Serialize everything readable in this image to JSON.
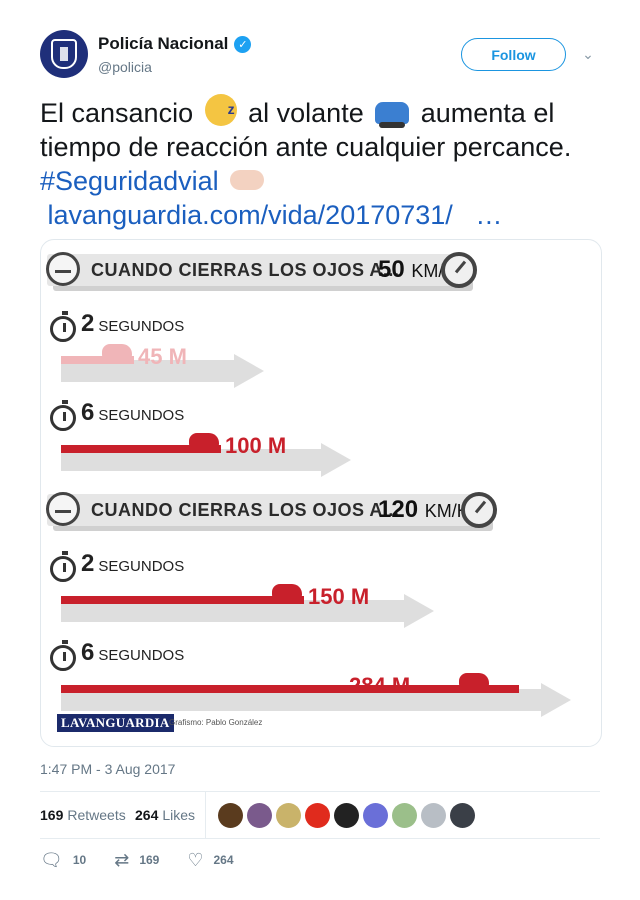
{
  "author": {
    "display_name": "Policía Nacional",
    "handle": "@policia",
    "avatar_icon": "police-badge-icon",
    "verified_icon": "verified-badge-icon"
  },
  "follow_button": {
    "label": "Follow"
  },
  "menu_icon": "chevron-down-icon",
  "tweet": {
    "line1_part1": "El cansancio",
    "line1_part2": "al volante",
    "line1_part3": "aumenta el",
    "line2": "tiempo de reacción ante cualquier percance.",
    "hashtag": "#Seguridadvial",
    "link": "lavanguardia.com/vida/20170731/",
    "ellipsis": "…",
    "emojis": [
      "sleeping-face-icon",
      "car-icon",
      "pointing-hand-icon"
    ]
  },
  "infographic": {
    "panels": [
      {
        "heading": "CUANDO CIERRAS LOS OJOS A...",
        "speed": "50",
        "unit": "KM/H",
        "rows": [
          {
            "seconds": "2",
            "seconds_label": "SEGUNDOS",
            "distance": "45 M",
            "fraction": 0.16
          },
          {
            "seconds": "6",
            "seconds_label": "SEGUNDOS",
            "distance": "100 M",
            "fraction": 0.35
          }
        ]
      },
      {
        "heading": "CUANDO CIERRAS LOS OJOS A...",
        "speed": "120",
        "unit": "KM/H",
        "rows": [
          {
            "seconds": "2",
            "seconds_label": "SEGUNDOS",
            "distance": "150 M",
            "fraction": 0.53
          },
          {
            "seconds": "6",
            "seconds_label": "SEGUNDOS",
            "distance": "284 M",
            "fraction": 1.0
          }
        ]
      }
    ],
    "brand": "LAVANGUARDIA",
    "credit": "Grafismo: Pablo González"
  },
  "timestamp": "1:47 PM - 3 Aug 2017",
  "stats": {
    "retweets_count": "169",
    "retweets_label": "Retweets",
    "likes_count": "264",
    "likes_label": "Likes"
  },
  "likers": [
    {
      "color": "#5a3b1e"
    },
    {
      "color": "#7a5a8c"
    },
    {
      "color": "#c9b36a"
    },
    {
      "color": "#e02b1d"
    },
    {
      "color": "#222222"
    },
    {
      "color": "#6a6fd8"
    },
    {
      "color": "#9bbf8a"
    },
    {
      "color": "#b8bec5"
    },
    {
      "color": "#3a3f47"
    }
  ],
  "actions": {
    "reply_icon": "reply-icon",
    "reply_count": "10",
    "retweet_icon": "retweet-icon",
    "retweet_count": "169",
    "like_icon": "heart-icon",
    "like_count": "264"
  }
}
